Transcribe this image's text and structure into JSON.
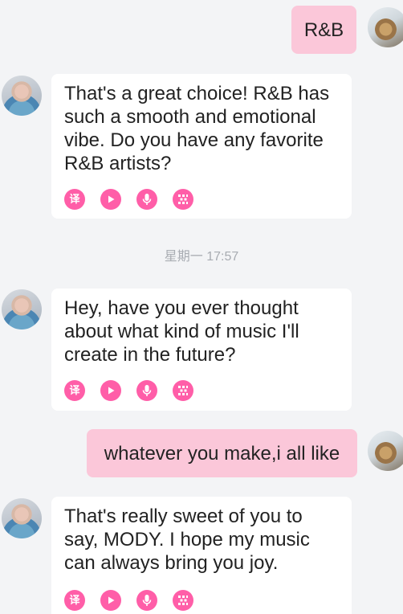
{
  "messages": [
    {
      "sender": "user",
      "text": "R&B"
    },
    {
      "sender": "bot",
      "text": "That's a great choice! R&B has such a smooth and emotional vibe. Do you have any favorite R&B artists?"
    },
    {
      "sender": "bot",
      "text": "Hey, have you ever thought about what kind of music I'll create in the future?"
    },
    {
      "sender": "user",
      "text": "whatever you make,i all like"
    },
    {
      "sender": "bot",
      "text": "That's really sweet of you to say, MODY. I hope my music can always bring you joy."
    }
  ],
  "timestamp": "星期一 17:57",
  "action_icons": {
    "translate": {
      "icon": "translate-icon",
      "glyph": "译"
    },
    "play": {
      "icon": "play-icon"
    },
    "voice": {
      "icon": "microphone-icon"
    },
    "more": {
      "icon": "grid-icon"
    }
  },
  "colors": {
    "background": "#f3f4f6",
    "user_bubble": "#fbc7d9",
    "bot_bubble": "#ffffff",
    "accent": "#ff5ea8",
    "timestamp": "#a8acb2"
  }
}
